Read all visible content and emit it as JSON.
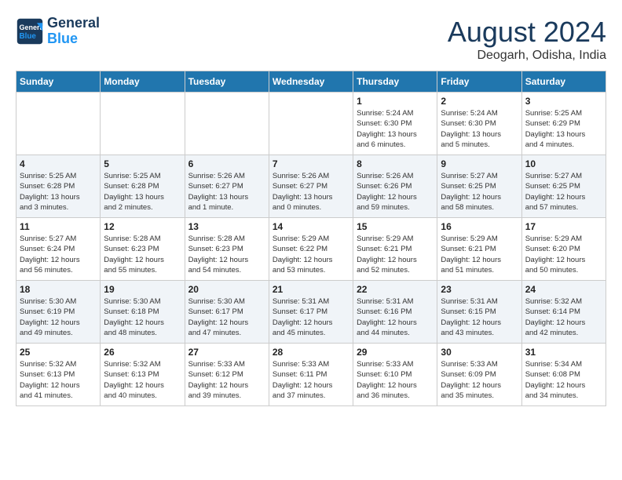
{
  "header": {
    "logo_line1": "General",
    "logo_line2": "Blue",
    "month": "August 2024",
    "location": "Deogarh, Odisha, India"
  },
  "weekdays": [
    "Sunday",
    "Monday",
    "Tuesday",
    "Wednesday",
    "Thursday",
    "Friday",
    "Saturday"
  ],
  "weeks": [
    [
      {
        "day": "",
        "info": ""
      },
      {
        "day": "",
        "info": ""
      },
      {
        "day": "",
        "info": ""
      },
      {
        "day": "",
        "info": ""
      },
      {
        "day": "1",
        "info": "Sunrise: 5:24 AM\nSunset: 6:30 PM\nDaylight: 13 hours\nand 6 minutes."
      },
      {
        "day": "2",
        "info": "Sunrise: 5:24 AM\nSunset: 6:30 PM\nDaylight: 13 hours\nand 5 minutes."
      },
      {
        "day": "3",
        "info": "Sunrise: 5:25 AM\nSunset: 6:29 PM\nDaylight: 13 hours\nand 4 minutes."
      }
    ],
    [
      {
        "day": "4",
        "info": "Sunrise: 5:25 AM\nSunset: 6:28 PM\nDaylight: 13 hours\nand 3 minutes."
      },
      {
        "day": "5",
        "info": "Sunrise: 5:25 AM\nSunset: 6:28 PM\nDaylight: 13 hours\nand 2 minutes."
      },
      {
        "day": "6",
        "info": "Sunrise: 5:26 AM\nSunset: 6:27 PM\nDaylight: 13 hours\nand 1 minute."
      },
      {
        "day": "7",
        "info": "Sunrise: 5:26 AM\nSunset: 6:27 PM\nDaylight: 13 hours\nand 0 minutes."
      },
      {
        "day": "8",
        "info": "Sunrise: 5:26 AM\nSunset: 6:26 PM\nDaylight: 12 hours\nand 59 minutes."
      },
      {
        "day": "9",
        "info": "Sunrise: 5:27 AM\nSunset: 6:25 PM\nDaylight: 12 hours\nand 58 minutes."
      },
      {
        "day": "10",
        "info": "Sunrise: 5:27 AM\nSunset: 6:25 PM\nDaylight: 12 hours\nand 57 minutes."
      }
    ],
    [
      {
        "day": "11",
        "info": "Sunrise: 5:27 AM\nSunset: 6:24 PM\nDaylight: 12 hours\nand 56 minutes."
      },
      {
        "day": "12",
        "info": "Sunrise: 5:28 AM\nSunset: 6:23 PM\nDaylight: 12 hours\nand 55 minutes."
      },
      {
        "day": "13",
        "info": "Sunrise: 5:28 AM\nSunset: 6:23 PM\nDaylight: 12 hours\nand 54 minutes."
      },
      {
        "day": "14",
        "info": "Sunrise: 5:29 AM\nSunset: 6:22 PM\nDaylight: 12 hours\nand 53 minutes."
      },
      {
        "day": "15",
        "info": "Sunrise: 5:29 AM\nSunset: 6:21 PM\nDaylight: 12 hours\nand 52 minutes."
      },
      {
        "day": "16",
        "info": "Sunrise: 5:29 AM\nSunset: 6:21 PM\nDaylight: 12 hours\nand 51 minutes."
      },
      {
        "day": "17",
        "info": "Sunrise: 5:29 AM\nSunset: 6:20 PM\nDaylight: 12 hours\nand 50 minutes."
      }
    ],
    [
      {
        "day": "18",
        "info": "Sunrise: 5:30 AM\nSunset: 6:19 PM\nDaylight: 12 hours\nand 49 minutes."
      },
      {
        "day": "19",
        "info": "Sunrise: 5:30 AM\nSunset: 6:18 PM\nDaylight: 12 hours\nand 48 minutes."
      },
      {
        "day": "20",
        "info": "Sunrise: 5:30 AM\nSunset: 6:17 PM\nDaylight: 12 hours\nand 47 minutes."
      },
      {
        "day": "21",
        "info": "Sunrise: 5:31 AM\nSunset: 6:17 PM\nDaylight: 12 hours\nand 45 minutes."
      },
      {
        "day": "22",
        "info": "Sunrise: 5:31 AM\nSunset: 6:16 PM\nDaylight: 12 hours\nand 44 minutes."
      },
      {
        "day": "23",
        "info": "Sunrise: 5:31 AM\nSunset: 6:15 PM\nDaylight: 12 hours\nand 43 minutes."
      },
      {
        "day": "24",
        "info": "Sunrise: 5:32 AM\nSunset: 6:14 PM\nDaylight: 12 hours\nand 42 minutes."
      }
    ],
    [
      {
        "day": "25",
        "info": "Sunrise: 5:32 AM\nSunset: 6:13 PM\nDaylight: 12 hours\nand 41 minutes."
      },
      {
        "day": "26",
        "info": "Sunrise: 5:32 AM\nSunset: 6:13 PM\nDaylight: 12 hours\nand 40 minutes."
      },
      {
        "day": "27",
        "info": "Sunrise: 5:33 AM\nSunset: 6:12 PM\nDaylight: 12 hours\nand 39 minutes."
      },
      {
        "day": "28",
        "info": "Sunrise: 5:33 AM\nSunset: 6:11 PM\nDaylight: 12 hours\nand 37 minutes."
      },
      {
        "day": "29",
        "info": "Sunrise: 5:33 AM\nSunset: 6:10 PM\nDaylight: 12 hours\nand 36 minutes."
      },
      {
        "day": "30",
        "info": "Sunrise: 5:33 AM\nSunset: 6:09 PM\nDaylight: 12 hours\nand 35 minutes."
      },
      {
        "day": "31",
        "info": "Sunrise: 5:34 AM\nSunset: 6:08 PM\nDaylight: 12 hours\nand 34 minutes."
      }
    ]
  ]
}
